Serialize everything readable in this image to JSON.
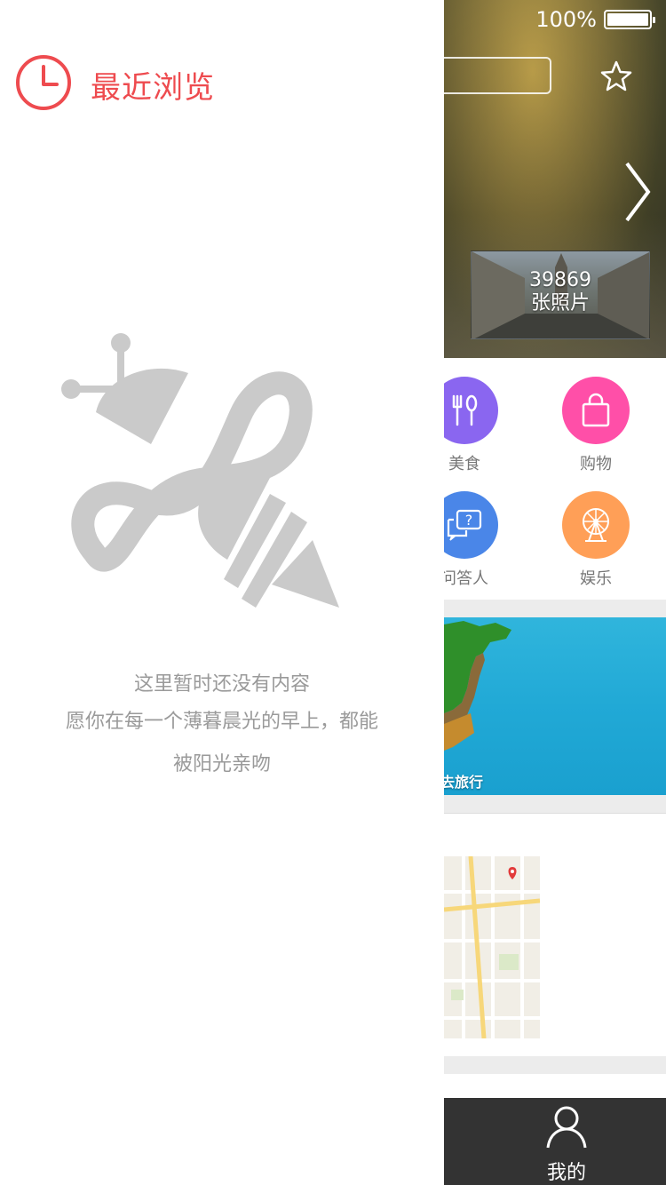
{
  "drawer": {
    "title": "最近浏览",
    "icon": "clock-icon",
    "empty_line1": "这里暂时还没有内容",
    "empty_line2": "愿你在每一个薄暮晨光的早上，都能",
    "empty_line3": "被阳光亲吻",
    "accent_color": "#ee4b4f"
  },
  "status_bar": {
    "battery_text": "100%",
    "battery_level": 1.0
  },
  "hero": {
    "photo_count": "39869",
    "photo_label": "张照片"
  },
  "categories": [
    {
      "label": "美食",
      "icon": "fork-spoon-icon",
      "color": "#8a66f0"
    },
    {
      "label": "购物",
      "icon": "shopping-bag-icon",
      "color": "#ff4fa8"
    },
    {
      "label": "问答人",
      "icon": "chat-question-icon",
      "color": "#4a86e8"
    },
    {
      "label": "娱乐",
      "icon": "ferris-wheel-icon",
      "color": "#ff9f57"
    }
  ],
  "banner": {
    "text": "去旅行"
  },
  "tabbar": {
    "me_label": "我的"
  }
}
